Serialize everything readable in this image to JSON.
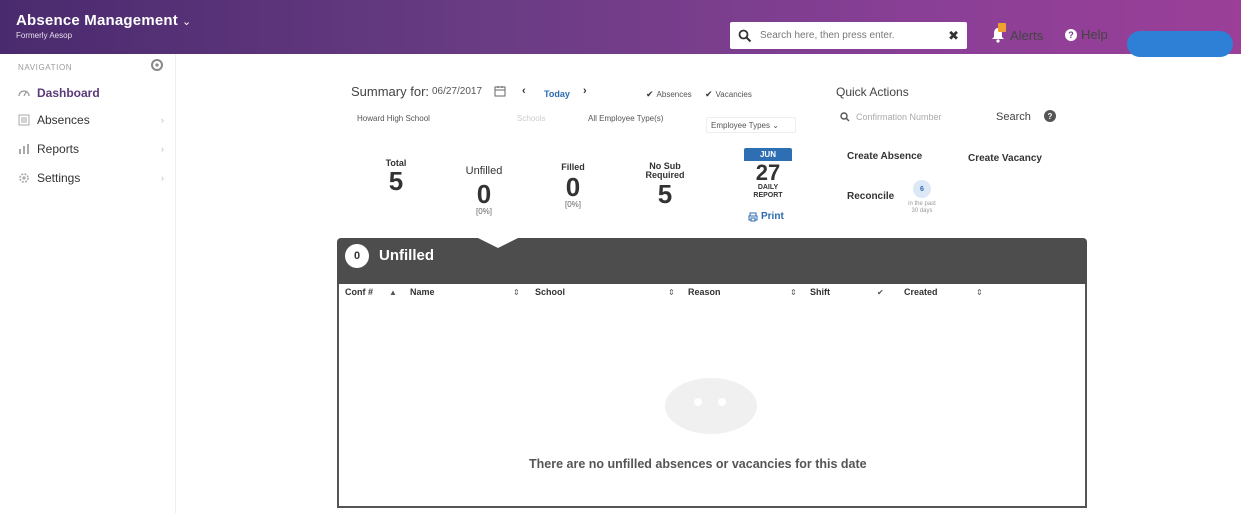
{
  "header": {
    "title": "Absence Management",
    "subtitle": "Formerly Aesop",
    "search_placeholder": "Search here, then press enter.",
    "alerts_label": "Alerts",
    "help_label": "Help",
    "accent_color": "#6a3c84"
  },
  "sidebar": {
    "heading": "NAVIGATION",
    "items": [
      {
        "label": "Dashboard",
        "icon": "dashboard-icon",
        "active": true
      },
      {
        "label": "Absences",
        "icon": "list-icon"
      },
      {
        "label": "Reports",
        "icon": "chart-icon"
      },
      {
        "label": "Settings",
        "icon": "gear-icon"
      }
    ]
  },
  "summary": {
    "label": "Summary for:",
    "date": "06/27/2017",
    "today_label": "Today",
    "absences_label": "Absences",
    "vacancies_label": "Vacancies",
    "school_filter": "Howard High School",
    "faded_filter": "Schools",
    "employee_type_filter": "All Employee Type(s)",
    "employee_types_select": "Employee Types"
  },
  "stats": {
    "total": {
      "label": "Total",
      "value": "5"
    },
    "unfilled": {
      "label": "Unfilled",
      "value": "0",
      "pct": "[0%]"
    },
    "filled": {
      "label": "Filled",
      "value": "0",
      "pct": "[0%]"
    },
    "no_sub": {
      "label_1": "No Sub",
      "label_2": "Required",
      "value": "5"
    },
    "calendar": {
      "month": "JUN",
      "day": "27",
      "daily": "DAILY",
      "report": "REPORT",
      "print": "Print"
    }
  },
  "quick_actions": {
    "title": "Quick Actions",
    "confirmation_placeholder": "Confirmation Number",
    "search_label": "Search",
    "create_absence": "Create Absence",
    "create_vacancy": "Create Vacancy",
    "reconcile": "Reconcile",
    "reconcile_count": "6",
    "reconcile_note_1": "in the past",
    "reconcile_note_2": "30 days"
  },
  "panel": {
    "count": "0",
    "title": "Unfilled",
    "columns": [
      "Conf #",
      "Name",
      "School",
      "Reason",
      "Shift",
      "Created"
    ],
    "empty_message": "There are no unfilled absences or vacancies for this date"
  }
}
